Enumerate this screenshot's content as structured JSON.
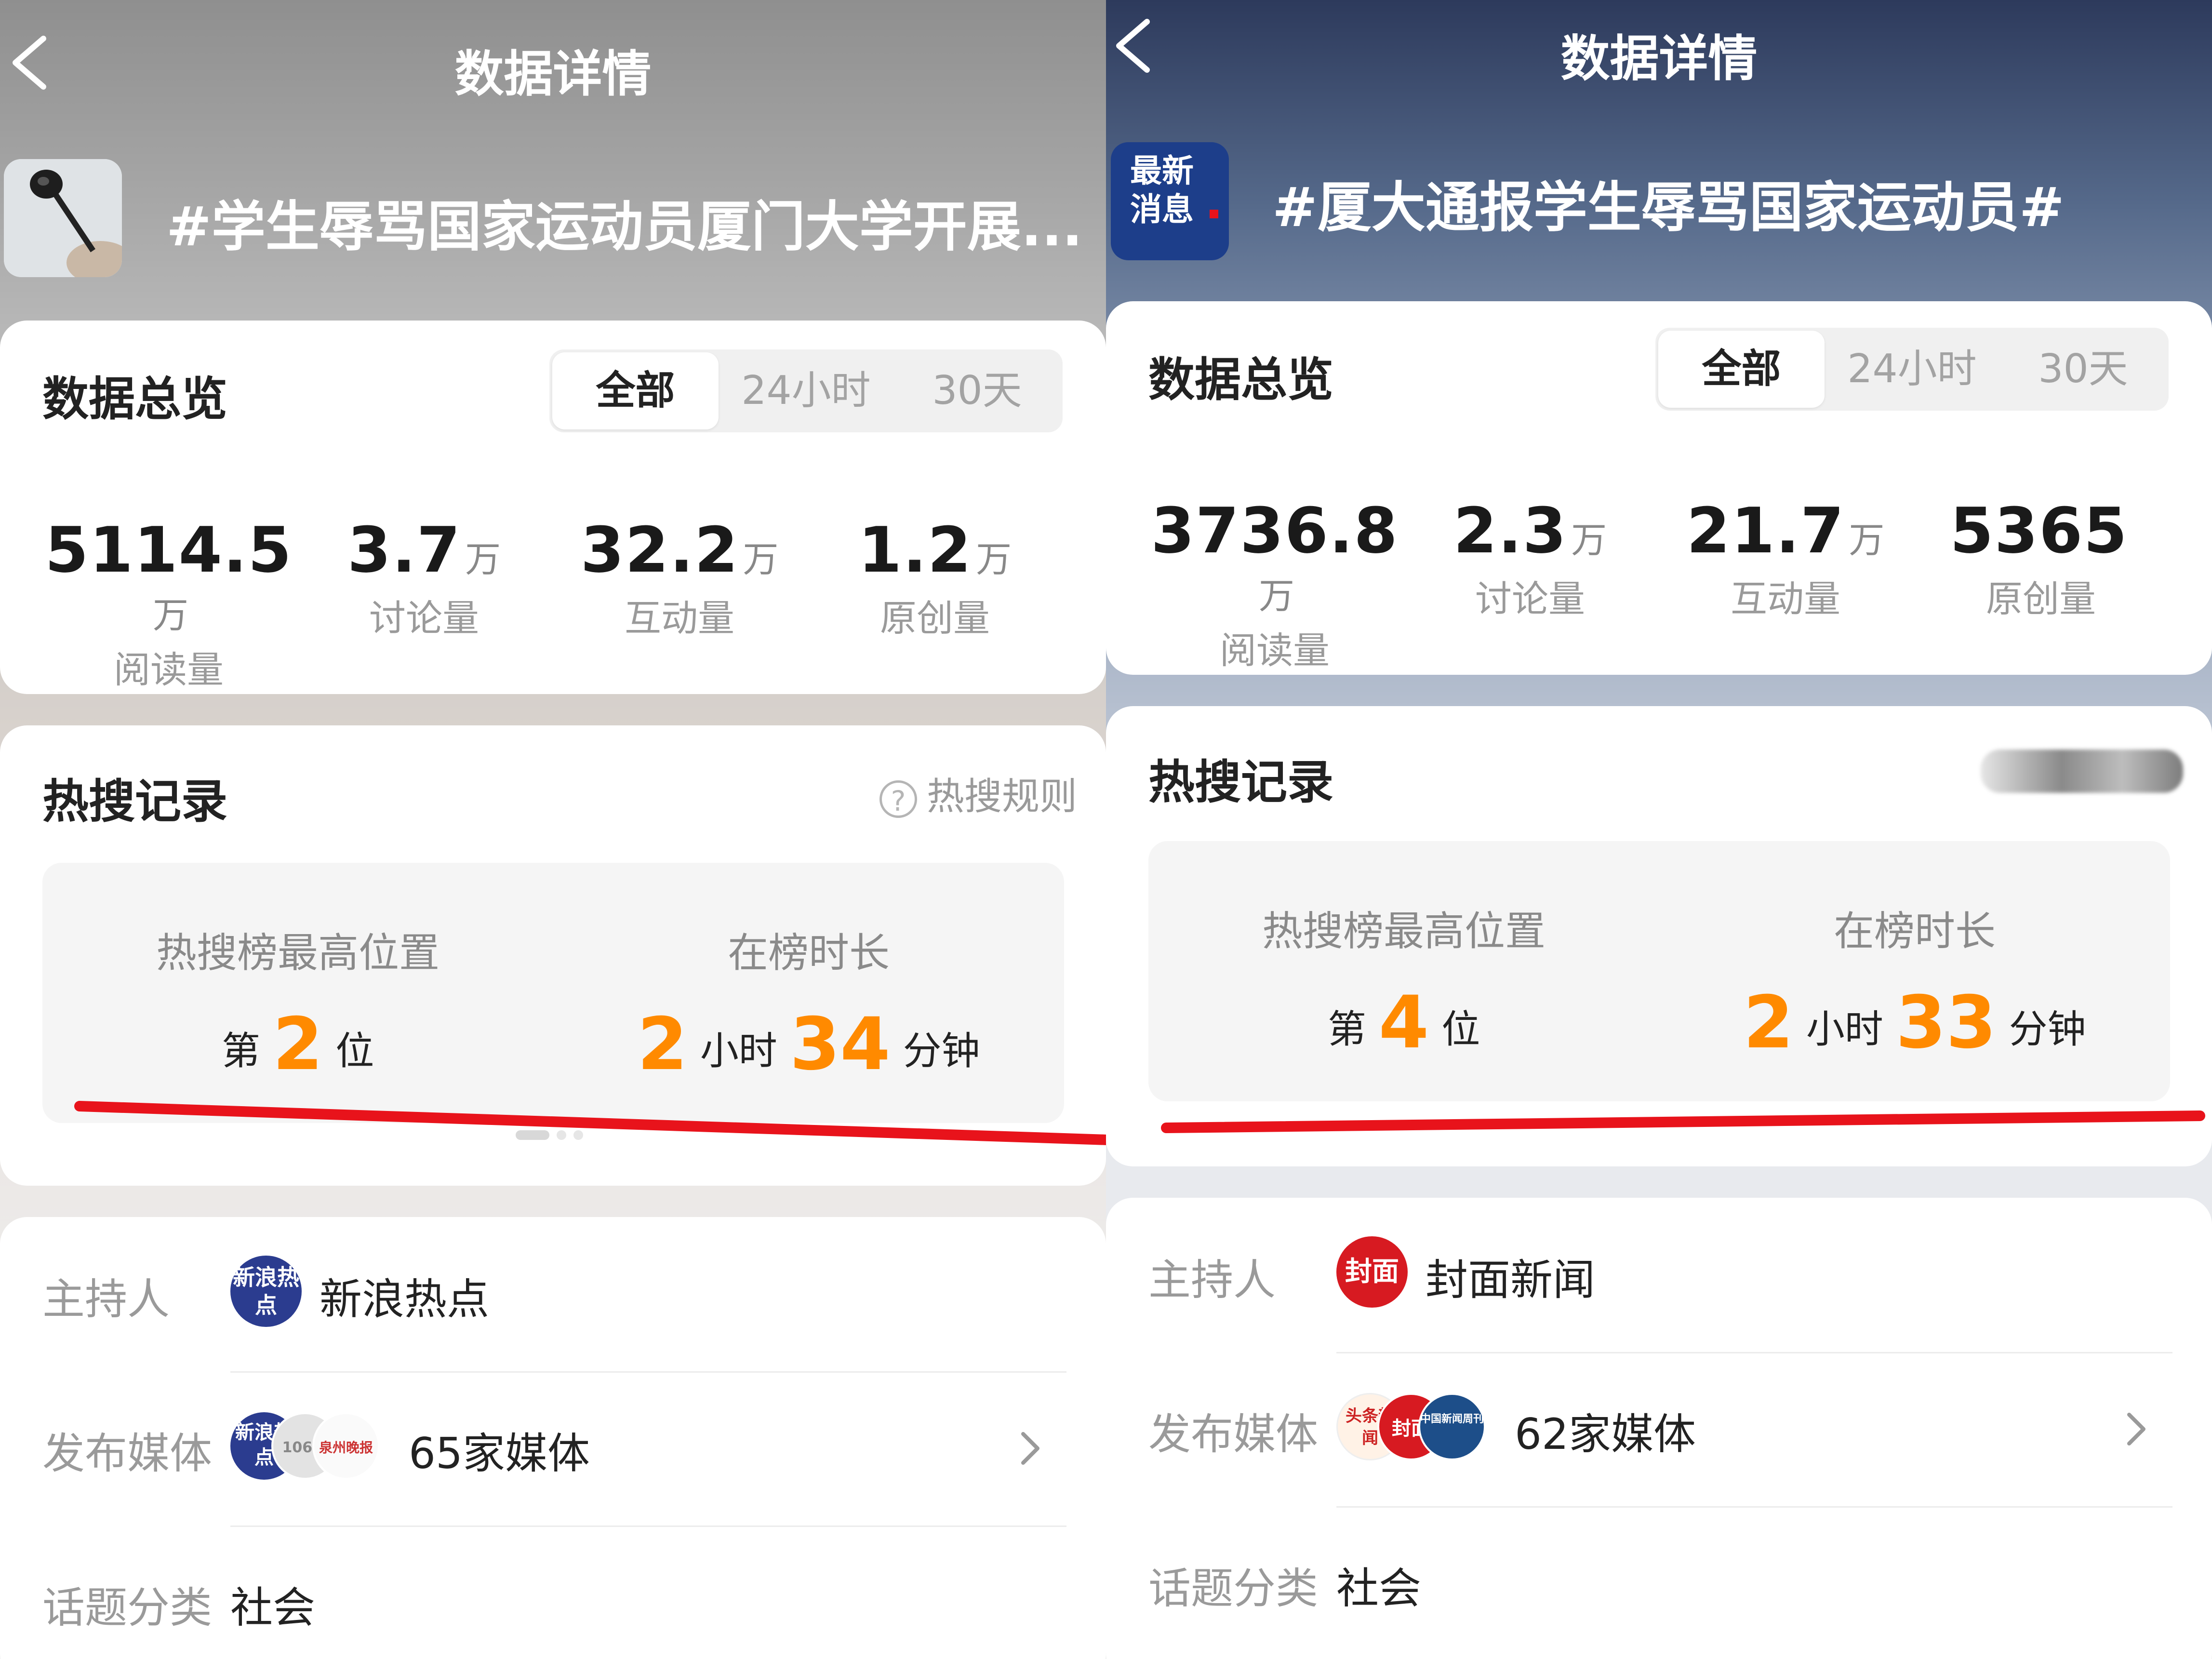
{
  "left": {
    "nav_title": "数据详情",
    "topic_title": "#学生辱骂国家运动员厦门大学开展...",
    "overview": {
      "title": "数据总览",
      "tabs": [
        "全部",
        "24小时",
        "30天"
      ],
      "active_tab": "全部",
      "stats": [
        {
          "num": "5114.5",
          "unit": "万",
          "label": "阅读量"
        },
        {
          "num": "3.7",
          "unit": "万",
          "label": "讨论量"
        },
        {
          "num": "32.2",
          "unit": "万",
          "label": "互动量"
        },
        {
          "num": "1.2",
          "unit": "万",
          "label": "原创量"
        }
      ]
    },
    "hot": {
      "title": "热搜记录",
      "rules": "热搜规则",
      "peak_label": "热搜榜最高位置",
      "peak_prefix": "第",
      "peak_value": "2",
      "peak_suffix": "位",
      "duration_label": "在榜时长",
      "hours": "2",
      "hours_unit": "小时",
      "minutes": "34",
      "minutes_unit": "分钟"
    },
    "info": {
      "host_key": "主持人",
      "host_value": "新浪热点",
      "media_key": "发布媒体",
      "media_value": "65家媒体",
      "category_key": "话题分类",
      "category_value": "社会"
    },
    "icons": {
      "host_avatar_text": "新浪热点",
      "media_avatar_1": "新浪热点",
      "media_avatar_2": "106.1",
      "media_avatar_3": "泉州晚报"
    }
  },
  "right": {
    "nav_title": "数据详情",
    "topic_badge": "最新消息",
    "topic_title": "#厦大通报学生辱骂国家运动员#",
    "overview": {
      "title": "数据总览",
      "tabs": [
        "全部",
        "24小时",
        "30天"
      ],
      "active_tab": "全部",
      "stats": [
        {
          "num": "3736.8",
          "unit": "万",
          "label": "阅读量"
        },
        {
          "num": "2.3",
          "unit": "万",
          "label": "讨论量"
        },
        {
          "num": "21.7",
          "unit": "万",
          "label": "互动量"
        },
        {
          "num": "5365",
          "unit": "",
          "label": "原创量"
        }
      ]
    },
    "hot": {
      "title": "热搜记录",
      "peak_label": "热搜榜最高位置",
      "peak_prefix": "第",
      "peak_value": "4",
      "peak_suffix": "位",
      "duration_label": "在榜时长",
      "hours": "2",
      "hours_unit": "小时",
      "minutes": "33",
      "minutes_unit": "分钟"
    },
    "info": {
      "host_key": "主持人",
      "host_value": "封面新闻",
      "media_key": "发布媒体",
      "media_value": "62家媒体",
      "category_key": "话题分类",
      "category_value": "社会"
    },
    "icons": {
      "host_avatar_text": "封面",
      "media_avatar_1": "头条新闻",
      "media_avatar_2": "封面",
      "media_avatar_3": "中国新闻周刊"
    }
  },
  "colors": {
    "accent_orange": "#ff8a00",
    "underline_red": "#e8131b",
    "card_bg": "#ffffff",
    "muted_text": "#9a9a9a"
  }
}
